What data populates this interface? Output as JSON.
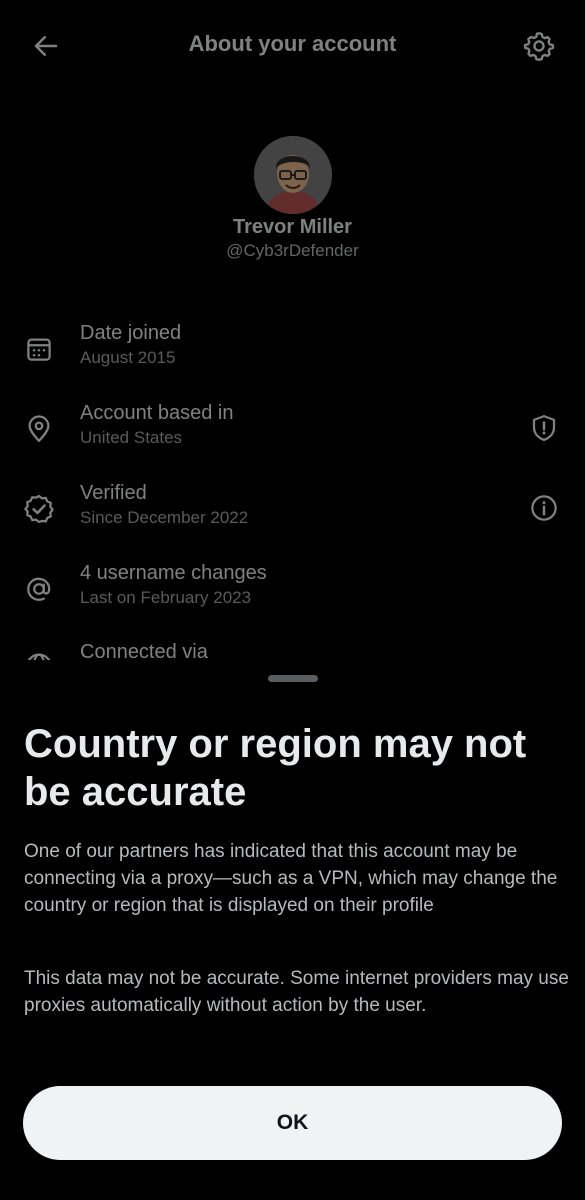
{
  "header": {
    "title": "About your account",
    "back_icon": "arrow-left-icon",
    "settings_icon": "gear-icon"
  },
  "profile": {
    "name": "Trevor Miller",
    "handle": "@Cyb3rDefender",
    "avatar_icon": "cartoon-avatar"
  },
  "info_rows": [
    {
      "title": "Date joined",
      "subtitle": "August 2015",
      "icon": "calendar-icon"
    },
    {
      "title": "Account based in",
      "subtitle": "United States",
      "icon": "location-pin-icon",
      "action_icon": "shield-alert-icon"
    },
    {
      "title": "Verified",
      "subtitle": "Since December 2022",
      "icon": "verified-badge-icon",
      "action_icon": "info-icon"
    },
    {
      "title": "4 username changes",
      "subtitle": "Last on February 2023",
      "icon": "at-sign-icon"
    },
    {
      "title": "Connected via",
      "subtitle": "",
      "icon": "globe-icon"
    }
  ],
  "sheet": {
    "title": "Country or region may not be accurate",
    "paragraph_1": "One of our partners has indicated that this account may be connecting via a proxy—such as a VPN, which may change the country or region that is displayed on their profile",
    "paragraph_2": "This data may not be accurate. Some internet providers may use proxies automatically without action by the user.",
    "ok_label": "OK"
  },
  "colors": {
    "background": "#000000",
    "text_primary": "#e7e9ea",
    "text_secondary": "#a0a4a7",
    "button_bg": "#eff3f4",
    "button_text": "#0f1419"
  }
}
